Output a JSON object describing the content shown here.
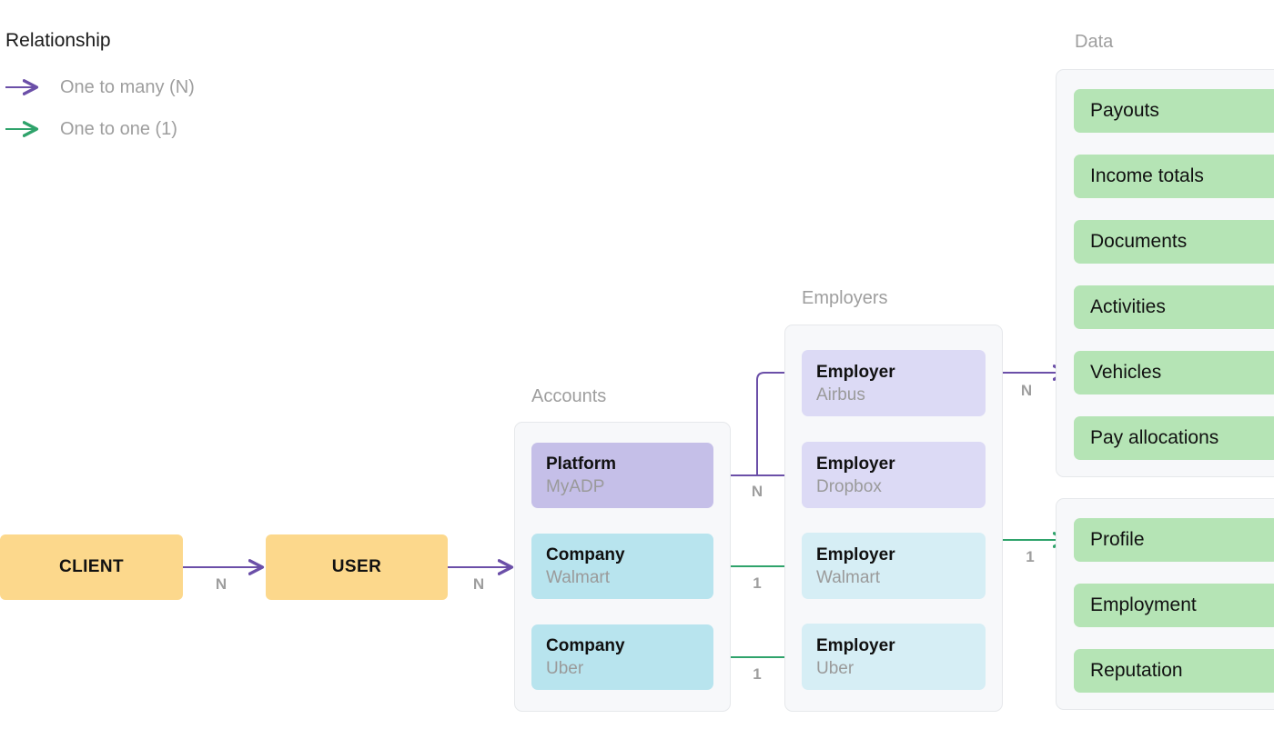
{
  "legend": {
    "title": "Relationship",
    "items": [
      {
        "label": "One to many (N)",
        "color": "#6b4fa8",
        "icon": "arrow-right-icon"
      },
      {
        "label": "One to one (1)",
        "color": "#2fa36b",
        "icon": "arrow-right-icon"
      }
    ]
  },
  "colors": {
    "one_to_many": "#6b4fa8",
    "one_to_one": "#2fa36b",
    "entity": "#fcd88c",
    "platform_card": "#c5bfe8",
    "company_card": "#b8e4ee",
    "employer_purple": "#dcdaf5",
    "employer_cyan": "#d6eef5",
    "data_chip": "#b5e4b5",
    "group_bg": "#f7f8fa",
    "group_border": "#e6e8eb",
    "muted_text": "#9e9e9e"
  },
  "entities": [
    {
      "label": "CLIENT"
    },
    {
      "label": "USER"
    }
  ],
  "groups": {
    "accounts": {
      "title": "Accounts",
      "cards": [
        {
          "title": "Platform",
          "subtitle": "MyADP",
          "variant": "purple"
        },
        {
          "title": "Company",
          "subtitle": "Walmart",
          "variant": "cyan"
        },
        {
          "title": "Company",
          "subtitle": "Uber",
          "variant": "cyan"
        }
      ]
    },
    "employers": {
      "title": "Employers",
      "cards": [
        {
          "title": "Employer",
          "subtitle": "Airbus",
          "variant": "lpurple"
        },
        {
          "title": "Employer",
          "subtitle": "Dropbox",
          "variant": "lpurple"
        },
        {
          "title": "Employer",
          "subtitle": "Walmart",
          "variant": "lcyan"
        },
        {
          "title": "Employer",
          "subtitle": "Uber",
          "variant": "lcyan"
        }
      ]
    },
    "data": {
      "title": "Data",
      "chips_primary": [
        {
          "label": "Payouts"
        },
        {
          "label": "Income totals"
        },
        {
          "label": "Documents"
        },
        {
          "label": "Activities"
        },
        {
          "label": "Vehicles"
        },
        {
          "label": "Pay allocations"
        }
      ],
      "chips_secondary": [
        {
          "label": "Profile"
        },
        {
          "label": "Employment"
        },
        {
          "label": "Reputation"
        }
      ]
    }
  },
  "edge_labels": {
    "client_user": "N",
    "user_accounts": "N",
    "platform_employers": "N",
    "walmart_employer": "1",
    "uber_employer": "1",
    "airbus_data": "N",
    "walmart_profile": "1"
  }
}
